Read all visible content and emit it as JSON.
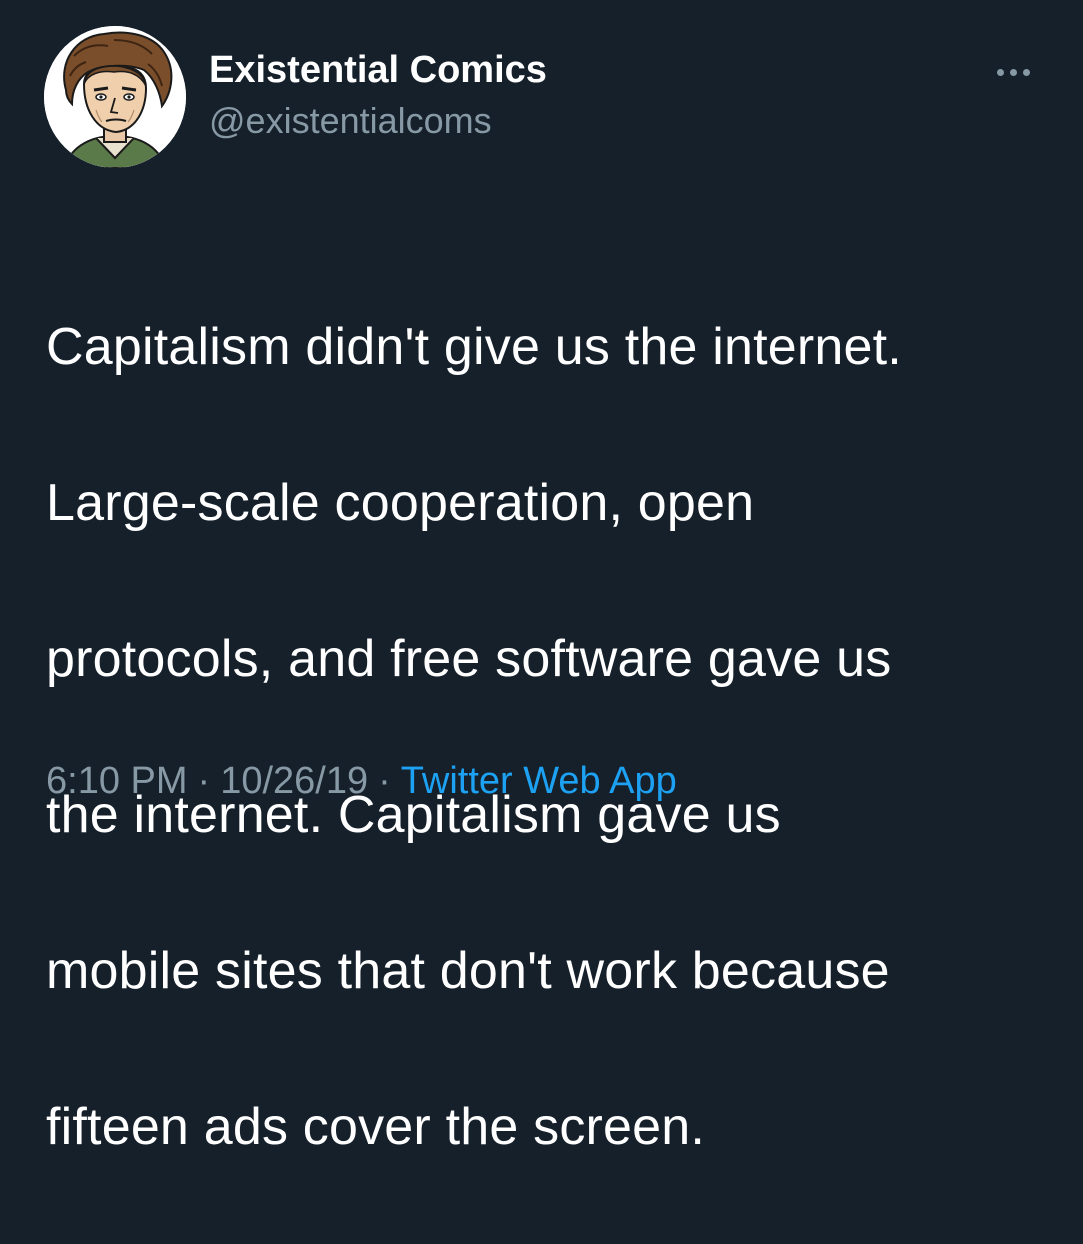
{
  "theme": {
    "background": "#15202b",
    "text": "#ffffff",
    "muted": "#8899a6",
    "link": "#1da1f2"
  },
  "author": {
    "display_name": "Existential Comics",
    "handle": "@existentialcoms",
    "avatar_icon": "cartoon-portrait-avatar"
  },
  "tweet": {
    "text_lines": [
      "Capitalism didn't give us the internet.",
      "Large-scale cooperation, open",
      "protocols, and free software gave us",
      "the internet. Capitalism gave us",
      "mobile sites that don't work because",
      "fifteen ads cover the screen."
    ]
  },
  "meta": {
    "time": "6:10 PM",
    "date": "10/26/19",
    "separator": "·",
    "source": "Twitter Web App"
  },
  "actions": {
    "more_icon": "more-horizontal-icon"
  }
}
